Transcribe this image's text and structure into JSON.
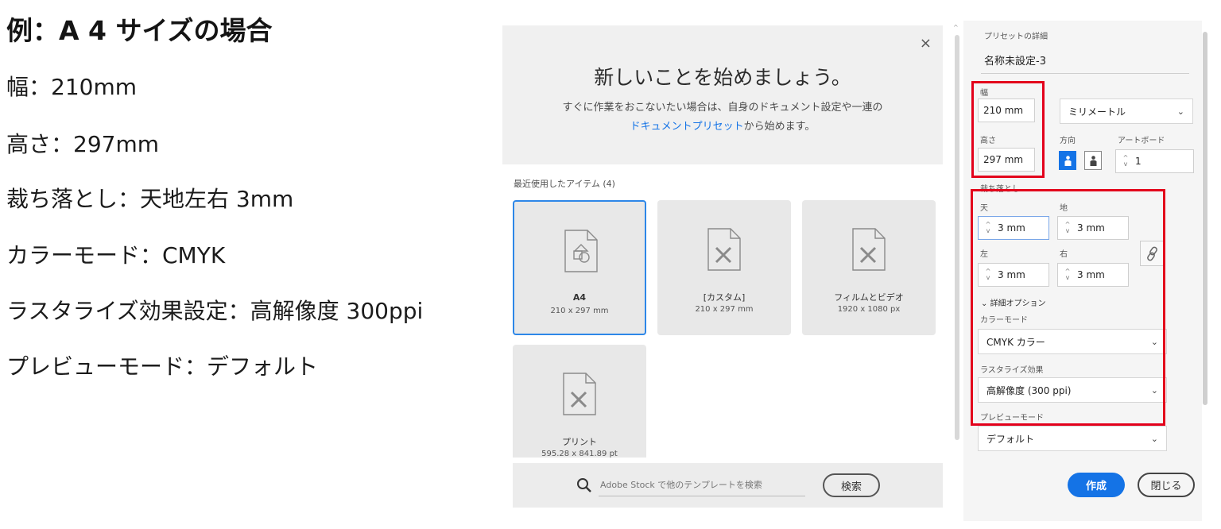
{
  "spec": {
    "title": "例：A 4 サイズの場合",
    "lines": [
      "幅：210mm",
      "高さ：297mm",
      "裁ち落とし：天地左右 3mm",
      "カラーモード：CMYK",
      "ラスタライズ効果設定：高解像度 300ppi",
      "プレビューモード：デフォルト"
    ]
  },
  "dialog": {
    "close_icon": "×",
    "title": "新しいことを始めましょう。",
    "desc_line1": "すぐに作業をおこないたい場合は、自身のドキュメント設定や一連の",
    "desc_link": "ドキュメントプリセット",
    "desc_line2_rest": "から始めます。",
    "recent_label": "最近使用したアイテム (4)",
    "recent_items": [
      {
        "name": "A4",
        "size": "210 x 297 mm",
        "icon": "a4-document-icon"
      },
      {
        "name": "[カスタム]",
        "size": "210 x 297 mm",
        "icon": "custom-document-icon"
      },
      {
        "name": "フィルムとビデオ",
        "size": "1920 x 1080 px",
        "icon": "film-document-icon"
      },
      {
        "name": "プリント",
        "size": "595.28 x 841.89 pt",
        "icon": "print-document-icon"
      }
    ],
    "stock_placeholder": "Adobe Stock で他のテンプレートを検索",
    "stock_button": "検索"
  },
  "preset": {
    "heading": "プリセットの詳細",
    "name": "名称未設定-3",
    "width_label": "幅",
    "width_value": "210 mm",
    "unit": "ミリメートル",
    "height_label": "高さ",
    "height_value": "297 mm",
    "orientation_label": "方向",
    "artboard_label": "アートボード",
    "artboard_value": "1",
    "bleed_label": "裁ち落とし",
    "bleed_top_label": "天",
    "bleed_top": "3 mm",
    "bleed_bottom_label": "地",
    "bleed_bottom": "3 mm",
    "bleed_left_label": "左",
    "bleed_left": "3 mm",
    "bleed_right_label": "右",
    "bleed_right": "3 mm",
    "advanced_label": "詳細オプション",
    "color_mode_label": "カラーモード",
    "color_mode": "CMYK カラー",
    "raster_label": "ラスタライズ効果",
    "raster_value": "高解像度 (300 ppi)",
    "preview_label": "プレビューモード",
    "preview_value": "デフォルト",
    "create_button": "作成",
    "close_button": "閉じる"
  },
  "colors": {
    "accent": "#1473e6",
    "highlight": "#e3001b",
    "selected_tile_border": "#2d87e8"
  }
}
